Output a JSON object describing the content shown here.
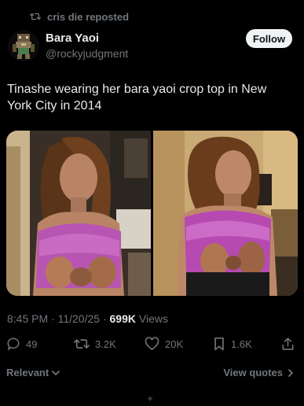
{
  "repost": {
    "label": "cris die reposted",
    "icon": "repost-icon"
  },
  "author": {
    "name": "Bara Yaoi",
    "handle": "@rockyjudgment",
    "avatar_icon": "pixel-art-avatar"
  },
  "follow_label": "Follow",
  "post": {
    "text": "Tinashe wearing her bara yaoi crop top in New York City in 2014"
  },
  "media": {
    "count": 2
  },
  "meta": {
    "time": "8:45 PM",
    "separator": " · ",
    "date": "11/20/25",
    "views_count": "699K",
    "views_label": " Views"
  },
  "actions": {
    "replies": "49",
    "reposts": "3.2K",
    "likes": "20K",
    "bookmarks": "1.6K",
    "reply_icon": "reply-icon",
    "repost_icon": "repost-icon",
    "like_icon": "heart-icon",
    "bookmark_icon": "bookmark-icon",
    "share_icon": "share-icon"
  },
  "replies_sort": {
    "label": "Relevant"
  },
  "view_quotes_label": "View quotes",
  "colors": {
    "background": "#000000",
    "text_primary": "#e7e9ea",
    "text_secondary": "#71767b",
    "follow_bg": "#eff3f4"
  }
}
